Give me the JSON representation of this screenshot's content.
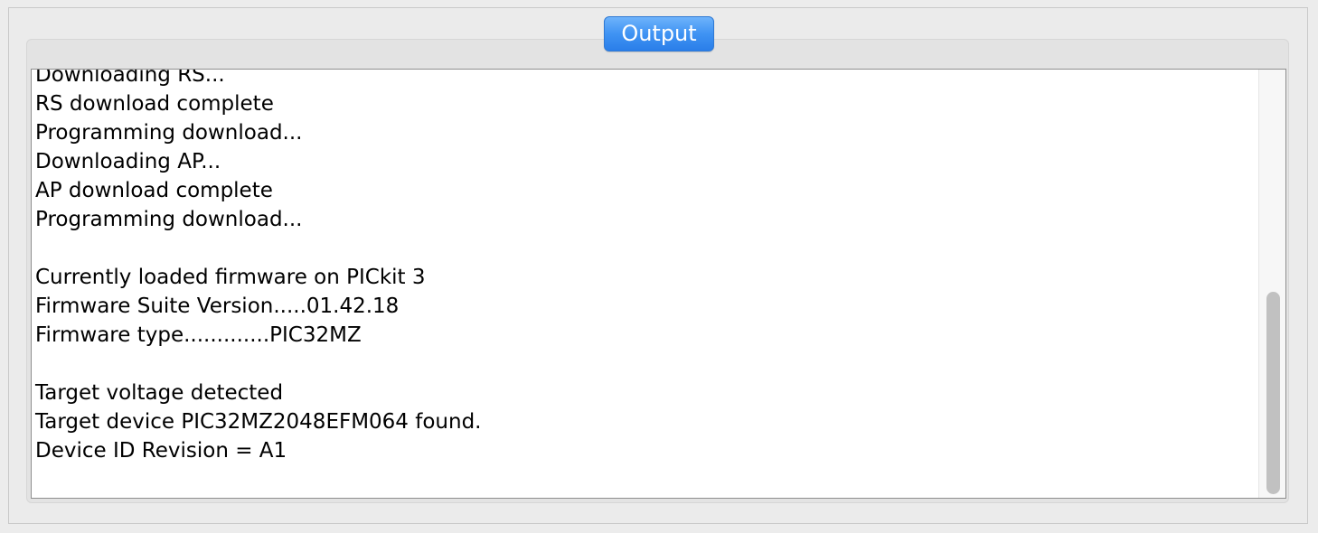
{
  "panel": {
    "tab_label": "Output"
  },
  "output": {
    "lines": [
      "Downloading RS...",
      "RS download complete",
      "Programming download...",
      "Downloading AP...",
      "AP download complete",
      "Programming download...",
      "",
      "Currently loaded firmware on PICkit 3",
      "Firmware Suite Version.....01.42.18",
      "Firmware type.............PIC32MZ",
      "",
      "Target voltage detected",
      "Target device PIC32MZ2048EFM064 found.",
      "Device ID Revision = A1"
    ]
  },
  "colors": {
    "tab_accent": "#3f93f3",
    "background": "#ececec",
    "text": "#000000"
  }
}
